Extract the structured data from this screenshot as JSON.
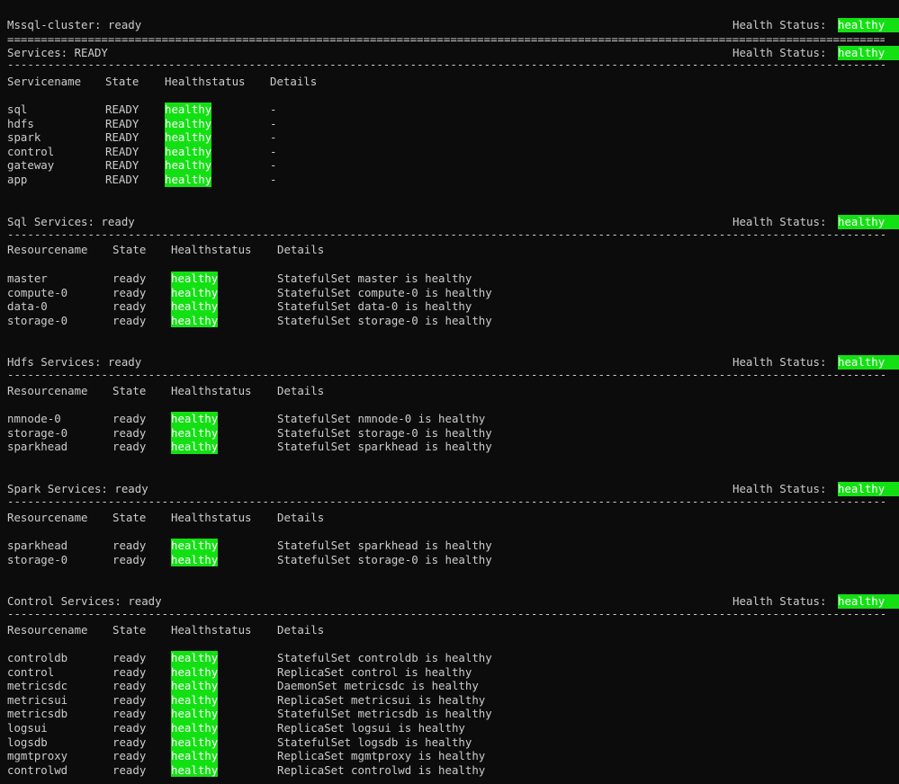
{
  "cluster": {
    "title": "Mssql-cluster: ready",
    "health_label": "Health Status:",
    "health_value": "healthy",
    "rule": "=============================================================================================================================================="
  },
  "dash_rule": "------------------------------------------------------------------------------------------------------------------------------------------------",
  "services": {
    "title": "Services: READY",
    "health_label": "Health Status:",
    "health_value": "healthy",
    "headers": [
      "Servicename",
      "State",
      "Healthstatus",
      "Details"
    ],
    "rows": [
      {
        "name": "sql",
        "state": "READY",
        "health": "healthy",
        "details": "-"
      },
      {
        "name": "hdfs",
        "state": "READY",
        "health": "healthy",
        "details": "-"
      },
      {
        "name": "spark",
        "state": "READY",
        "health": "healthy",
        "details": "-"
      },
      {
        "name": "control",
        "state": "READY",
        "health": "healthy",
        "details": "-"
      },
      {
        "name": "gateway",
        "state": "READY",
        "health": "healthy",
        "details": "-"
      },
      {
        "name": "app",
        "state": "READY",
        "health": "healthy",
        "details": "-"
      }
    ]
  },
  "sql": {
    "title": "Sql Services: ready",
    "health_label": "Health Status:",
    "health_value": "healthy",
    "headers": [
      "Resourcename",
      "State",
      "Healthstatus",
      "Details"
    ],
    "rows": [
      {
        "name": "master",
        "state": "ready",
        "health": "healthy",
        "details": "StatefulSet master is healthy"
      },
      {
        "name": "compute-0",
        "state": "ready",
        "health": "healthy",
        "details": "StatefulSet compute-0 is healthy"
      },
      {
        "name": "data-0",
        "state": "ready",
        "health": "healthy",
        "details": "StatefulSet data-0 is healthy"
      },
      {
        "name": "storage-0",
        "state": "ready",
        "health": "healthy",
        "details": "StatefulSet storage-0 is healthy"
      }
    ]
  },
  "hdfs": {
    "title": "Hdfs Services: ready",
    "health_label": "Health Status:",
    "health_value": "healthy",
    "headers": [
      "Resourcename",
      "State",
      "Healthstatus",
      "Details"
    ],
    "rows": [
      {
        "name": "nmnode-0",
        "state": "ready",
        "health": "healthy",
        "details": "StatefulSet nmnode-0 is healthy"
      },
      {
        "name": "storage-0",
        "state": "ready",
        "health": "healthy",
        "details": "StatefulSet storage-0 is healthy"
      },
      {
        "name": "sparkhead",
        "state": "ready",
        "health": "healthy",
        "details": "StatefulSet sparkhead is healthy"
      }
    ]
  },
  "spark": {
    "title": "Spark Services: ready",
    "health_label": "Health Status:",
    "health_value": "healthy",
    "headers": [
      "Resourcename",
      "State",
      "Healthstatus",
      "Details"
    ],
    "rows": [
      {
        "name": "sparkhead",
        "state": "ready",
        "health": "healthy",
        "details": "StatefulSet sparkhead is healthy"
      },
      {
        "name": "storage-0",
        "state": "ready",
        "health": "healthy",
        "details": "StatefulSet storage-0 is healthy"
      }
    ]
  },
  "control": {
    "title": "Control Services: ready",
    "health_label": "Health Status:",
    "health_value": "healthy",
    "headers": [
      "Resourcename",
      "State",
      "Healthstatus",
      "Details"
    ],
    "rows": [
      {
        "name": "controldb",
        "state": "ready",
        "health": "healthy",
        "details": "StatefulSet controldb is healthy"
      },
      {
        "name": "control",
        "state": "ready",
        "health": "healthy",
        "details": "ReplicaSet control is healthy"
      },
      {
        "name": "metricsdc",
        "state": "ready",
        "health": "healthy",
        "details": "DaemonSet metricsdc is healthy"
      },
      {
        "name": "metricsui",
        "state": "ready",
        "health": "healthy",
        "details": "ReplicaSet metricsui is healthy"
      },
      {
        "name": "metricsdb",
        "state": "ready",
        "health": "healthy",
        "details": "StatefulSet metricsdb is healthy"
      },
      {
        "name": "logsui",
        "state": "ready",
        "health": "healthy",
        "details": "ReplicaSet logsui is healthy"
      },
      {
        "name": "logsdb",
        "state": "ready",
        "health": "healthy",
        "details": "StatefulSet logsdb is healthy"
      },
      {
        "name": "mgmtproxy",
        "state": "ready",
        "health": "healthy",
        "details": "ReplicaSet mgmtproxy is healthy"
      },
      {
        "name": "controlwd",
        "state": "ready",
        "health": "healthy",
        "details": "ReplicaSet controlwd is healthy"
      }
    ]
  },
  "colors": {
    "background": "#0c0c0c",
    "text": "#cccccc",
    "healthy_highlight": "#13e013"
  }
}
